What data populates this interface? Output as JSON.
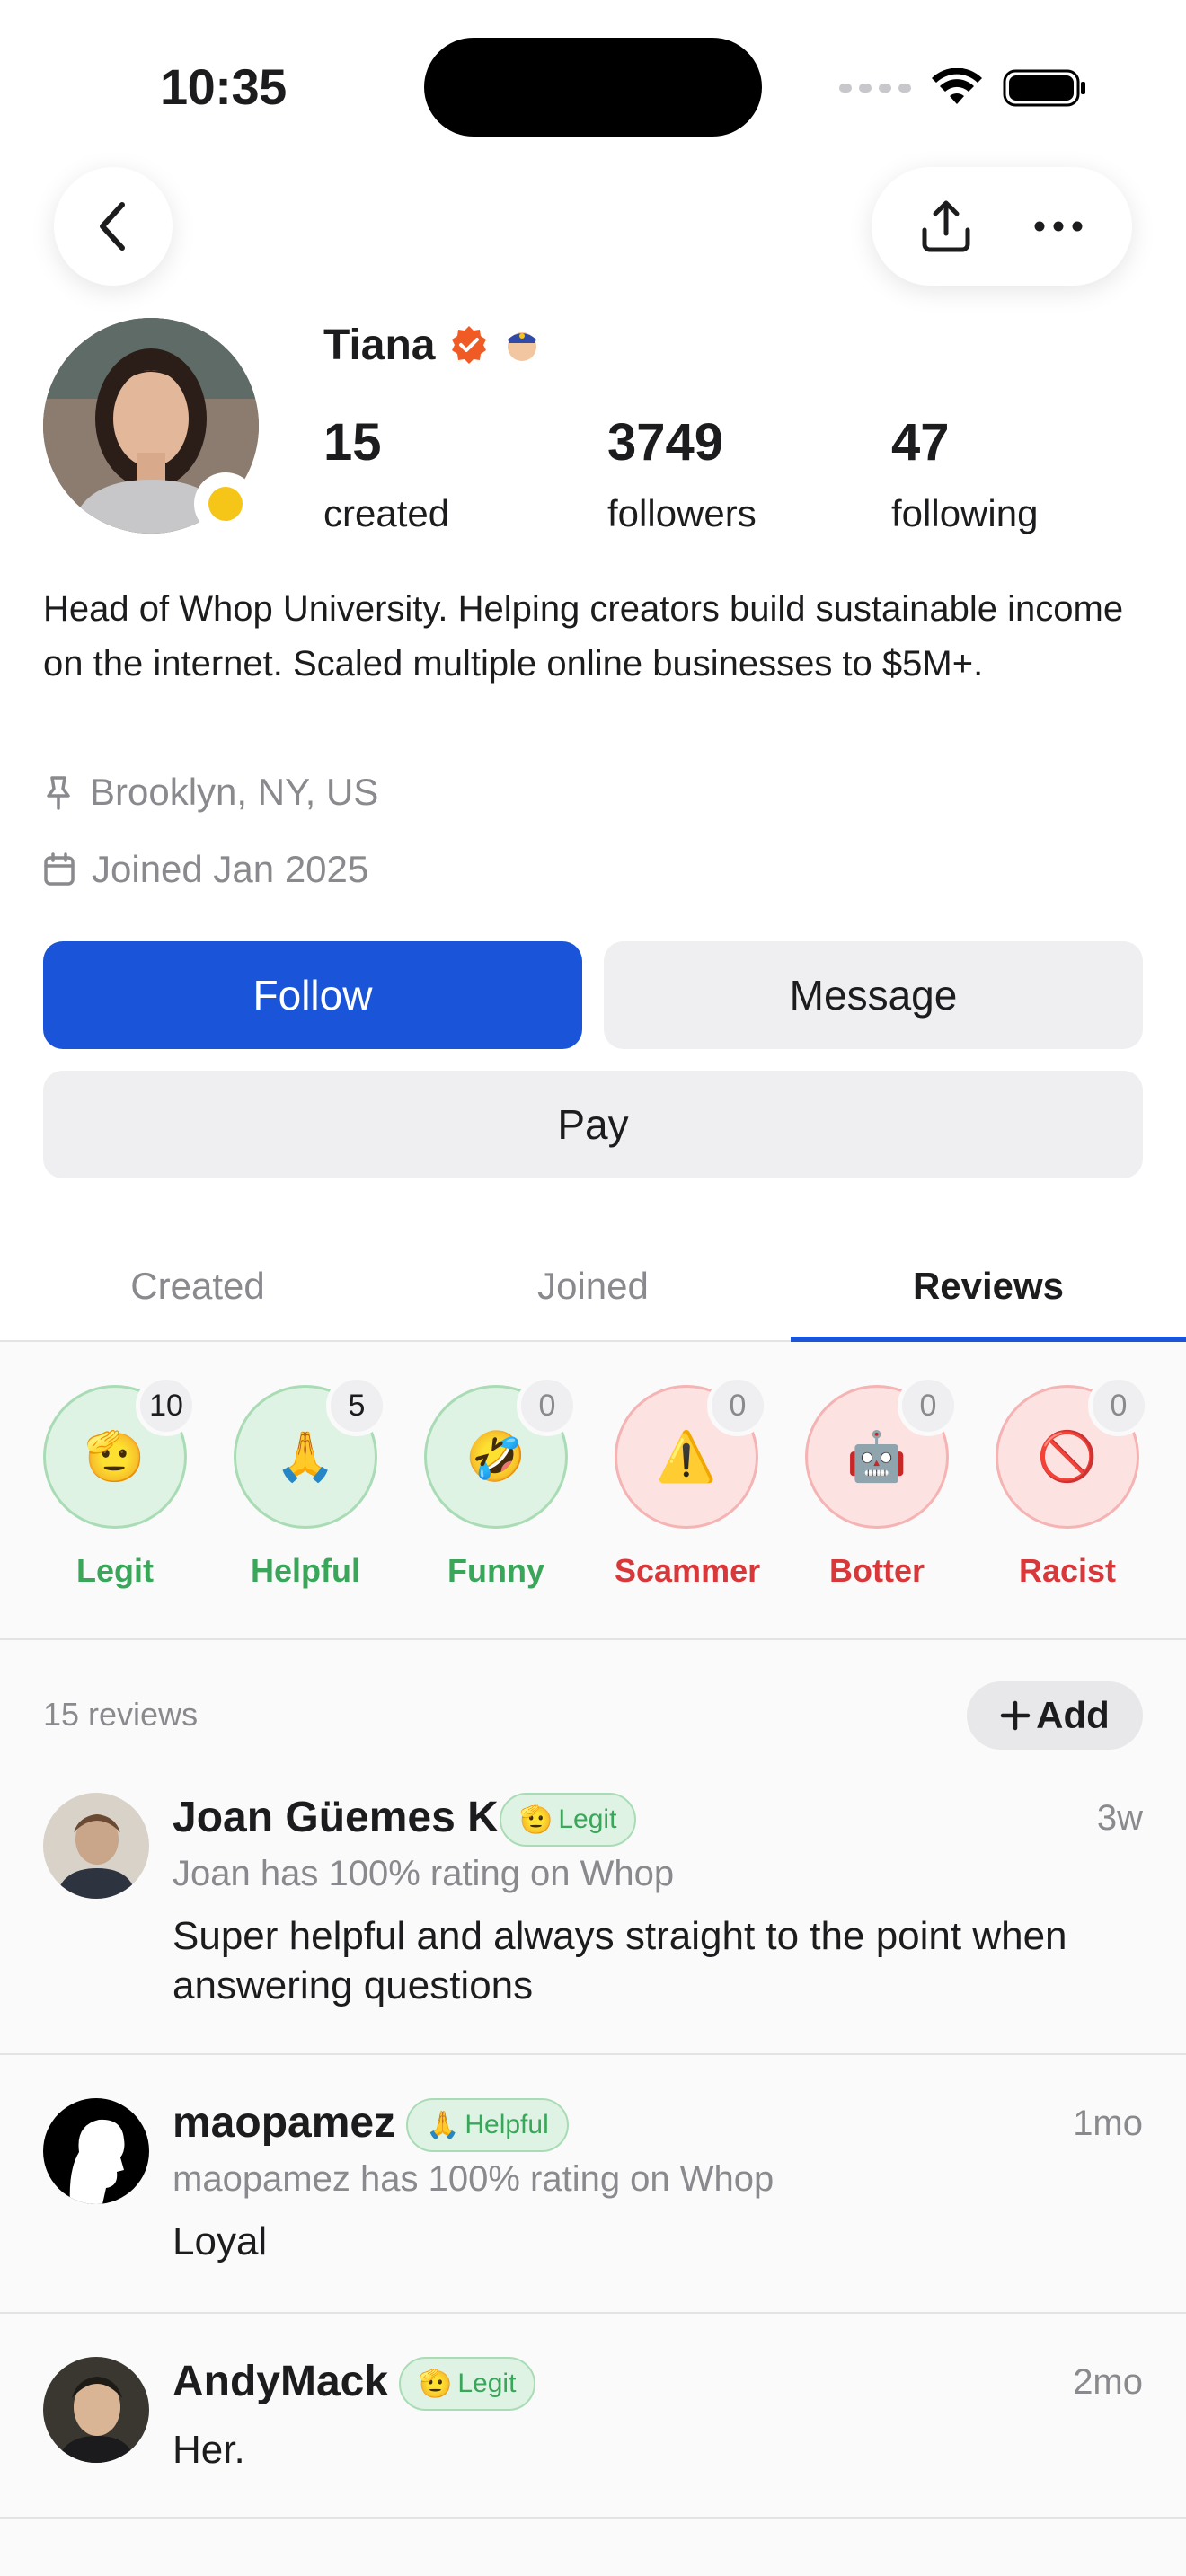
{
  "status_bar": {
    "time": "10:35"
  },
  "profile": {
    "name": "Tiana",
    "stats": [
      {
        "value": "15",
        "label": "created"
      },
      {
        "value": "3749",
        "label": "followers"
      },
      {
        "value": "47",
        "label": "following"
      }
    ],
    "bio": "Head of Whop University. Helping creators build sustainable income on the internet. Scaled multiple online businesses to $5M+.",
    "location": "Brooklyn, NY, US",
    "joined": "Joined Jan 2025"
  },
  "actions": {
    "follow": "Follow",
    "message": "Message",
    "pay": "Pay"
  },
  "tabs": [
    {
      "label": "Created",
      "active": false
    },
    {
      "label": "Joined",
      "active": false
    },
    {
      "label": "Reviews",
      "active": true
    }
  ],
  "reactions": [
    {
      "label": "Legit",
      "count": "10",
      "emoji": "🫡",
      "tone": "pos"
    },
    {
      "label": "Helpful",
      "count": "5",
      "emoji": "🙏",
      "tone": "pos"
    },
    {
      "label": "Funny",
      "count": "0",
      "emoji": "🤣",
      "tone": "pos"
    },
    {
      "label": "Scammer",
      "count": "0",
      "emoji": "⚠️",
      "tone": "neg"
    },
    {
      "label": "Botter",
      "count": "0",
      "emoji": "🤖",
      "tone": "neg"
    },
    {
      "label": "Racist",
      "count": "0",
      "emoji": "🚫",
      "tone": "neg"
    }
  ],
  "reviews_header": {
    "count": "15 reviews",
    "add": "Add"
  },
  "reviews": [
    {
      "name": "Joan Güemes K",
      "tag": "Legit",
      "tag_emoji": "🫡",
      "time": "3w",
      "sub": "Joan has 100% rating on Whop",
      "text": "Super helpful and always straight to the point when answering questions"
    },
    {
      "name": "maopamez",
      "tag": "Helpful",
      "tag_emoji": "🙏",
      "time": "1mo",
      "sub": "maopamez has 100% rating on Whop",
      "text": "Loyal"
    },
    {
      "name": "AndyMack",
      "tag": "Legit",
      "tag_emoji": "🫡",
      "time": "2mo",
      "sub": "",
      "text": "Her."
    }
  ],
  "colors": {
    "accent": "#1a54d9",
    "positive": "#3aa65a",
    "negative": "#d9383a",
    "verified": "#f05a24"
  },
  "icons": [
    "back-icon",
    "share-icon",
    "more-icon",
    "verified-badge-icon",
    "police-badge-icon",
    "pin-icon",
    "calendar-icon",
    "plus-icon"
  ]
}
